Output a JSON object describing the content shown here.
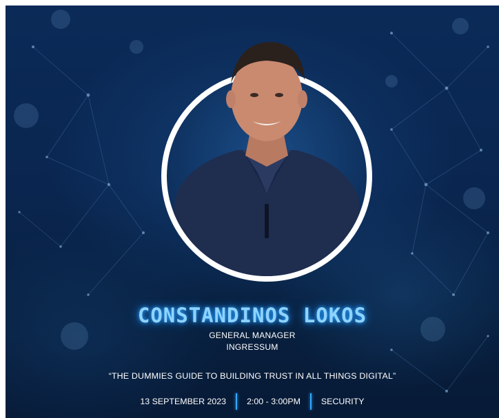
{
  "speaker": {
    "name": "CONSTANDINOS LOKOS",
    "title": "GENERAL MANAGER",
    "company": "INGRESSUM"
  },
  "talk": {
    "title": "“THE DUMMIES GUIDE TO BUILDING TRUST IN ALL THINGS DIGITAL”"
  },
  "session": {
    "date": "13 SEPTEMBER 2023",
    "time": "2:00 - 3:00PM",
    "track": "SECURITY"
  },
  "colors": {
    "background": "#0a2650",
    "name_glow": "#8fd3ff",
    "separator": "#33a9ff",
    "ring": "#ffffff"
  }
}
